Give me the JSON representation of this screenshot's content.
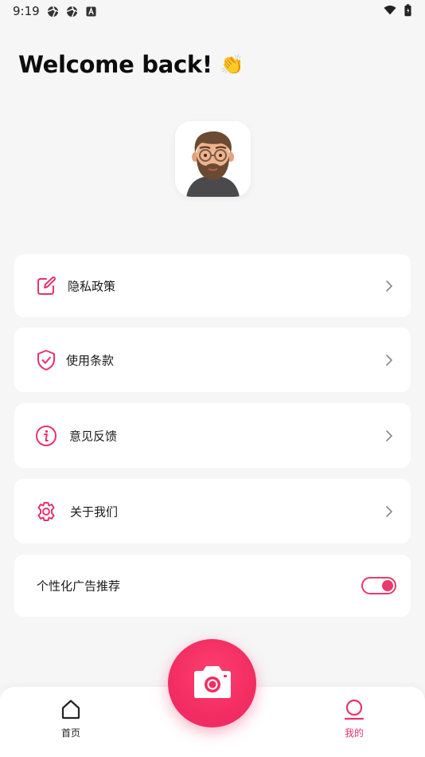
{
  "status_bar": {
    "time": "9:19",
    "left_icons": [
      "aperture-icon",
      "aperture-icon",
      "font-app-icon"
    ],
    "right_icons": [
      "wifi-icon",
      "battery-icon"
    ]
  },
  "header": {
    "welcome_text": "Welcome back!",
    "emoji": "👏"
  },
  "profile": {
    "avatar": "avatar-bearded-man"
  },
  "menu": {
    "items": [
      {
        "label": "隐私政策",
        "icon": "edit-icon"
      },
      {
        "label": "使用条款",
        "icon": "shield-check-icon"
      },
      {
        "label": "意见反馈",
        "icon": "info-icon"
      },
      {
        "label": "关于我们",
        "icon": "gear-icon"
      }
    ],
    "ad_toggle": {
      "label": "个性化广告推荐",
      "enabled": true
    }
  },
  "bottom_nav": {
    "tabs": [
      {
        "label": "首页",
        "icon": "home-icon",
        "active": false
      },
      {
        "label": "我的",
        "icon": "profile-icon",
        "active": true
      }
    ],
    "center_button": "camera-icon"
  },
  "colors": {
    "accent": "#e5346b",
    "background": "#f6f6f6",
    "card": "#ffffff"
  }
}
